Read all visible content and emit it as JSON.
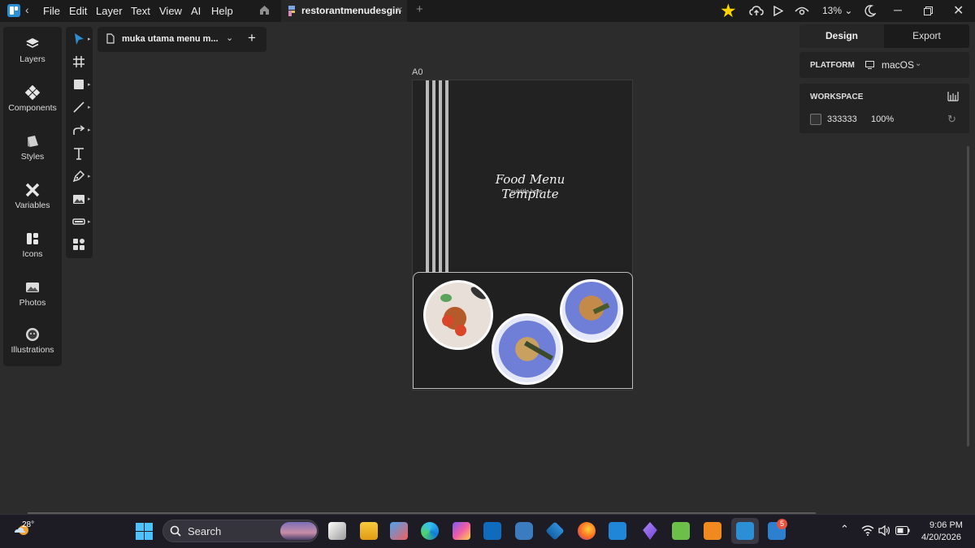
{
  "menu": [
    "File",
    "Edit",
    "Layer",
    "Text",
    "View",
    "AI",
    "Help"
  ],
  "tab": {
    "title": "restorantmenudesgin"
  },
  "toolbar": {
    "zoom": "13% ⌄"
  },
  "sidebar": {
    "items": [
      {
        "label": "Layers",
        "icon": "layers-icon"
      },
      {
        "label": "Components",
        "icon": "components-icon"
      },
      {
        "label": "Styles",
        "icon": "styles-icon"
      },
      {
        "label": "Variables",
        "icon": "variables-icon"
      },
      {
        "label": "Icons",
        "icon": "icons-icon"
      },
      {
        "label": "Photos",
        "icon": "photos-icon"
      },
      {
        "label": "Illustrations",
        "icon": "illustrations-icon"
      }
    ]
  },
  "page_panel": {
    "page_name": "muka utama menu m..."
  },
  "canvas": {
    "artboard_label": "A0",
    "title": "Food Menu Template",
    "subtitle": "subtitle here"
  },
  "right_panel": {
    "tabs": [
      "Design",
      "Export"
    ],
    "platform_label": "PLATFORM",
    "platform_value": "macOS",
    "workspace_label": "WORKSPACE",
    "workspace_color": "333333",
    "workspace_opacity": "100%"
  },
  "taskbar": {
    "weather": "28°",
    "search": "Search",
    "badge": "5",
    "time": "9:06 PM",
    "date": "4/20/2026"
  },
  "colors": {
    "accent": "#2c8fd6",
    "star": "#ffd400",
    "workspace": "#333333"
  }
}
